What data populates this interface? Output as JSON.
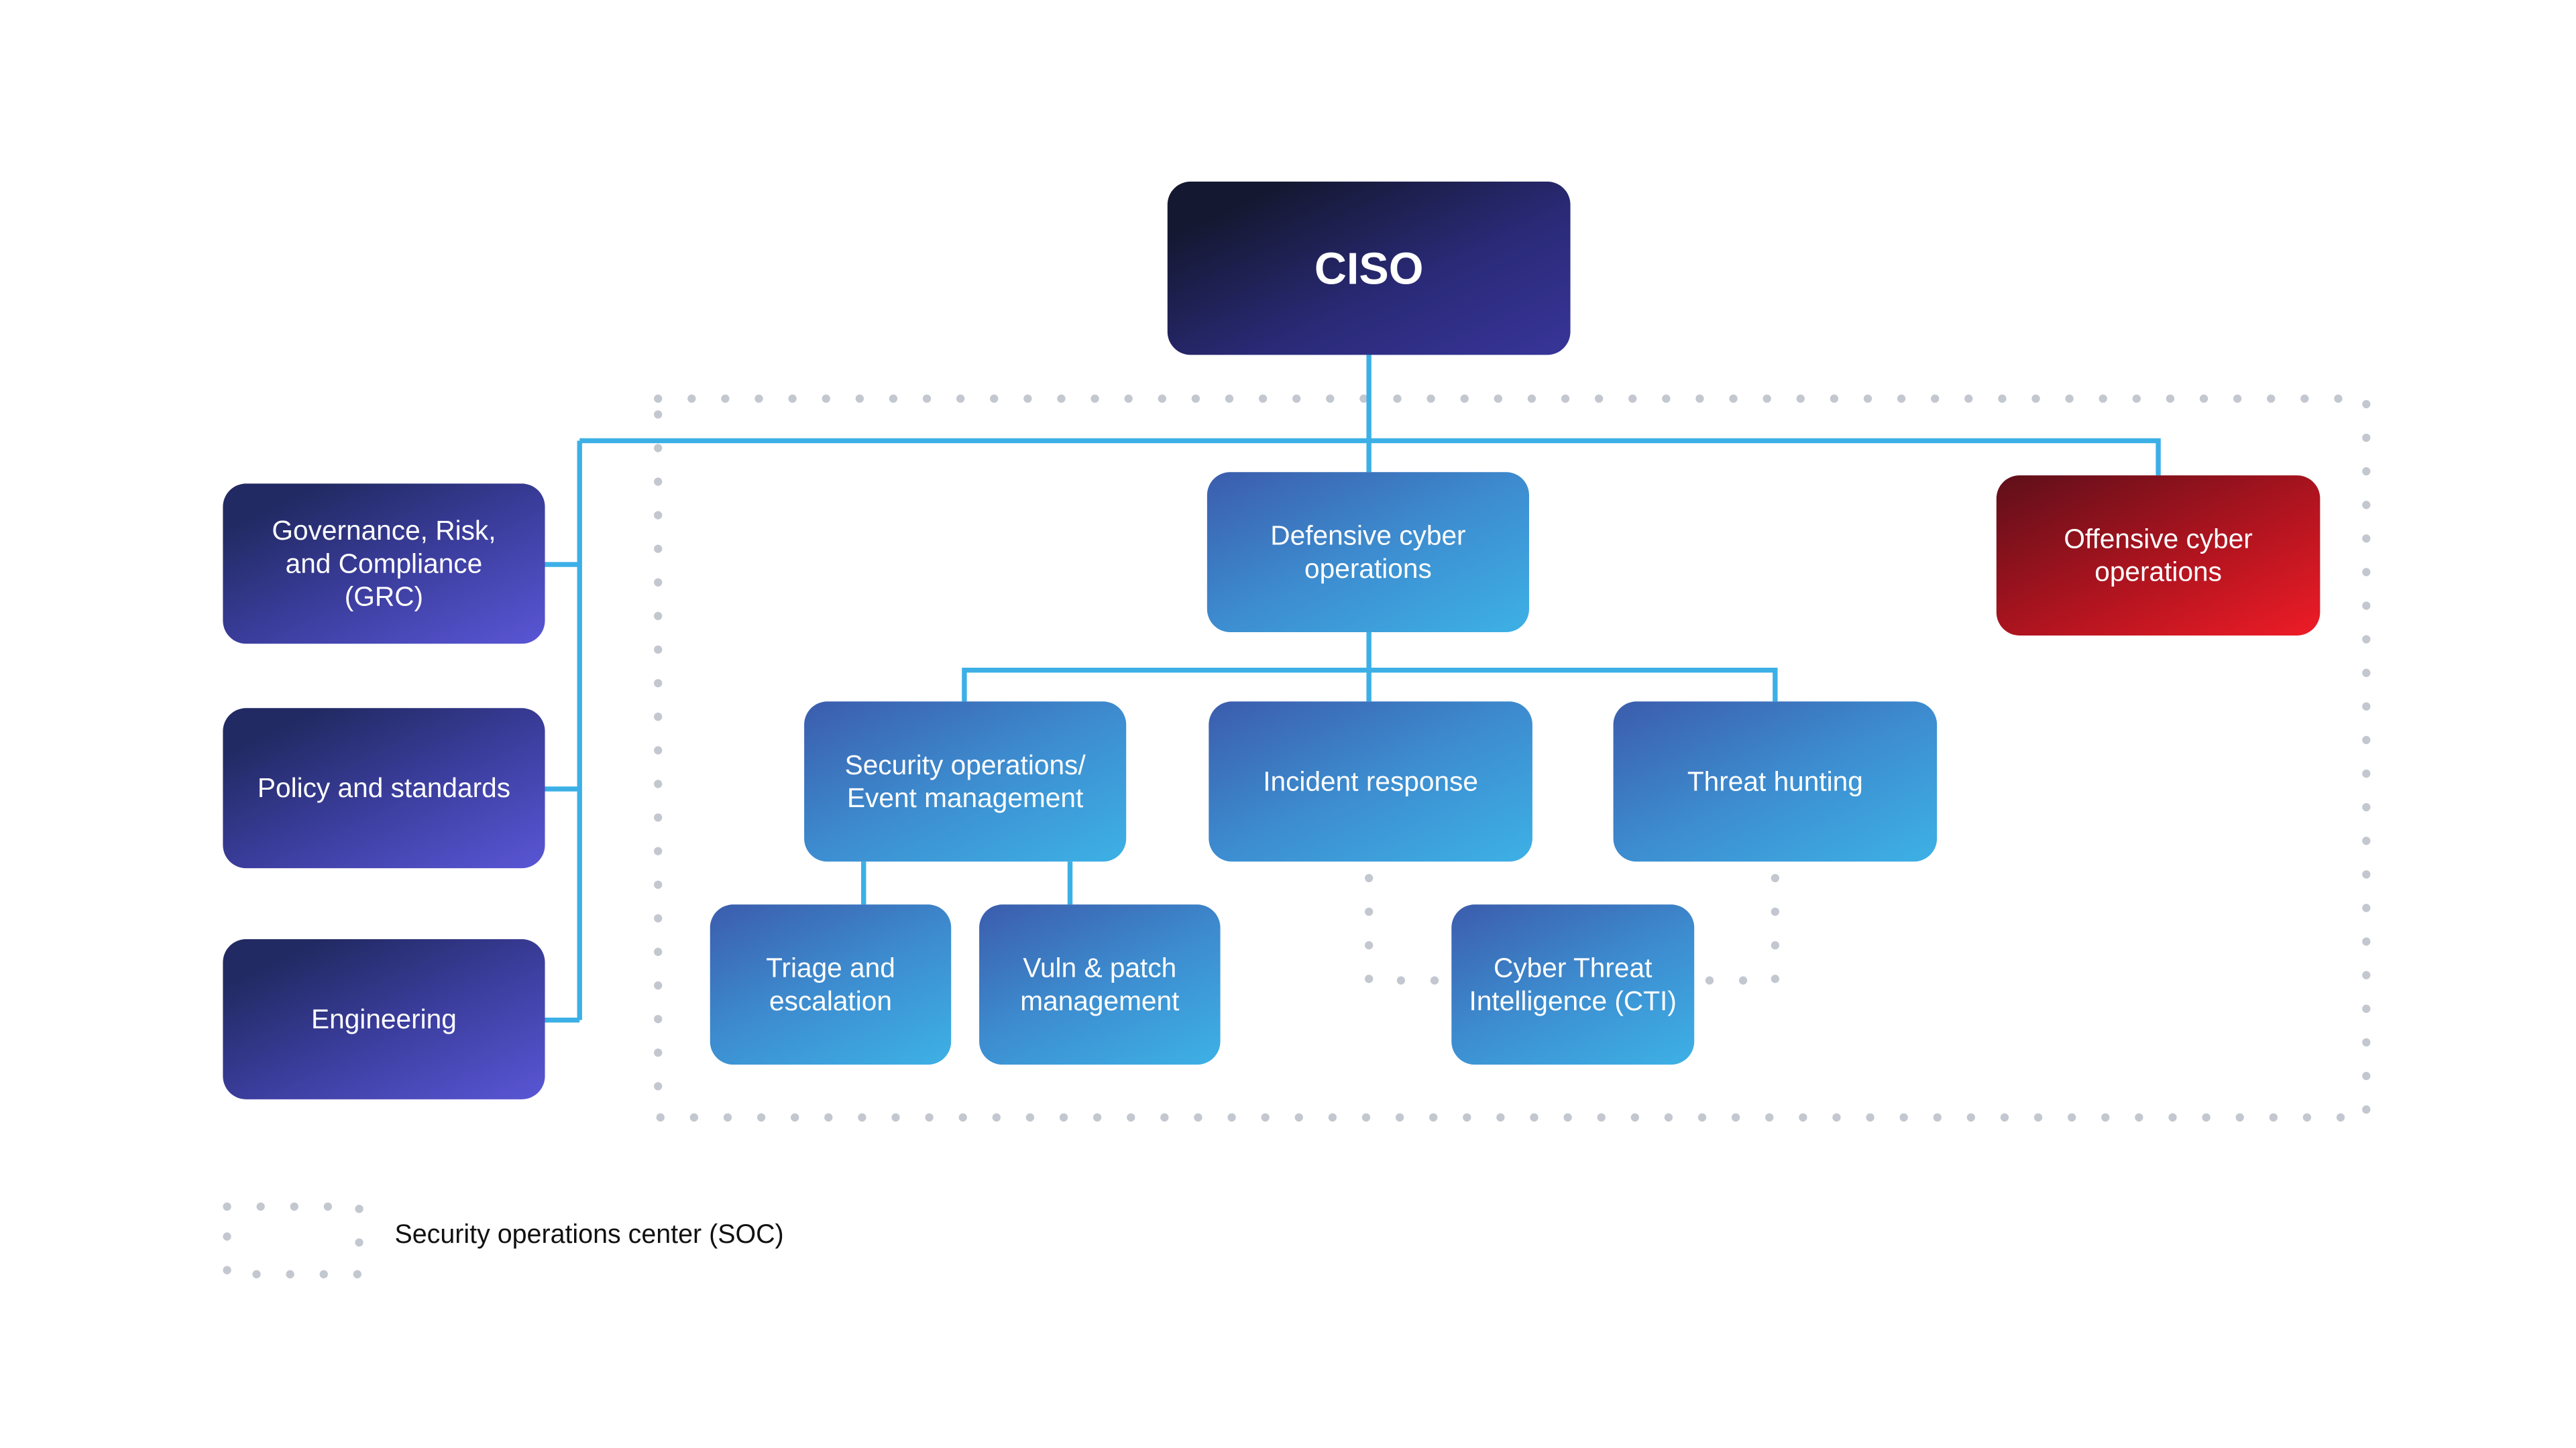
{
  "colors": {
    "connector": "#3cb0e6",
    "dots": "#c3c7cf",
    "ciso": "#2a2a78",
    "support": "#3c3e9e",
    "soc": "#3d8ccf",
    "offensive": "#c0161f"
  },
  "nodes": {
    "ciso": "CISO",
    "grc": "Governance, Risk,\nand Compliance\n(GRC)",
    "policy": "Policy and standards",
    "engineering": "Engineering",
    "defensive": "Defensive cyber\noperations",
    "offensive": "Offensive cyber\noperations",
    "secops": "Security operations/\nEvent management",
    "incident": "Incident response",
    "threat": "Threat hunting",
    "triage": "Triage and\nescalation",
    "vuln": "Vuln & patch\nmanagement",
    "cti": "Cyber Threat\nIntelligence (CTI)"
  },
  "legend": {
    "soc_label": "Security operations center (SOC)"
  }
}
